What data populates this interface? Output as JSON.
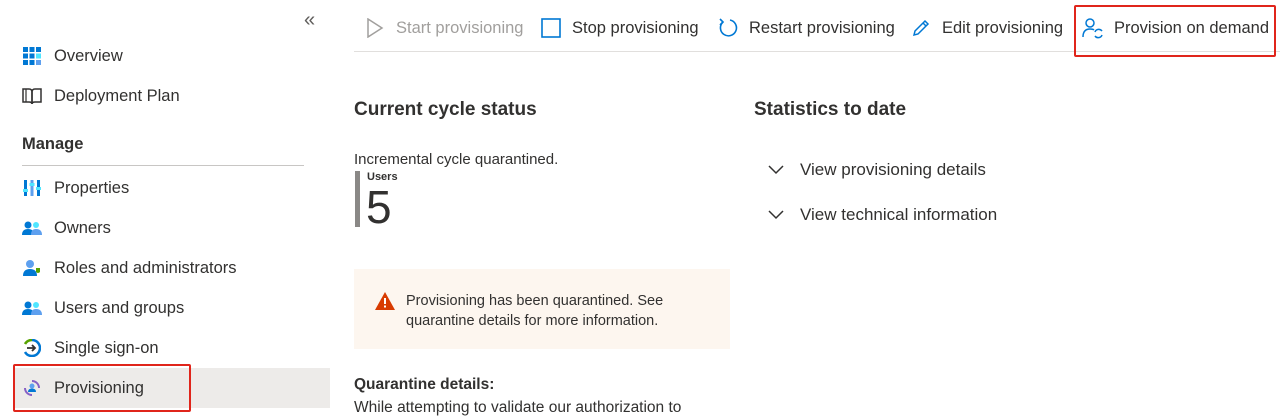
{
  "sidebar": {
    "collapse_glyph": "«",
    "items": [
      {
        "label": "Overview",
        "icon": "overview-grid-icon"
      },
      {
        "label": "Deployment Plan",
        "icon": "book-icon"
      }
    ],
    "manage_heading": "Manage",
    "manage_items": [
      {
        "label": "Properties",
        "icon": "properties-icon"
      },
      {
        "label": "Owners",
        "icon": "owners-icon"
      },
      {
        "label": "Roles and administrators",
        "icon": "roles-icon"
      },
      {
        "label": "Users and groups",
        "icon": "users-groups-icon"
      },
      {
        "label": "Single sign-on",
        "icon": "sso-icon"
      },
      {
        "label": "Provisioning",
        "icon": "provisioning-icon",
        "selected": true
      }
    ]
  },
  "toolbar": {
    "start": "Start provisioning",
    "stop": "Stop provisioning",
    "restart": "Restart provisioning",
    "edit": "Edit provisioning",
    "on_demand": "Provision on demand"
  },
  "status": {
    "heading": "Current cycle status",
    "cycle_text": "Incremental cycle quarantined.",
    "users_label": "Users",
    "users_count": "5"
  },
  "warning": {
    "line1": "Provisioning has been quarantined. See",
    "line2": "quarantine details for more information."
  },
  "quarantine": {
    "heading": "Quarantine details:",
    "text": "While attempting to validate our authorization to"
  },
  "stats": {
    "heading": "Statistics to date",
    "expanders": [
      "View provisioning details",
      "View technical information"
    ]
  },
  "colors": {
    "highlight": "#e0251b",
    "accent": "#0078d4",
    "warning": "#d83b01",
    "selected_bg": "#edebe9"
  }
}
